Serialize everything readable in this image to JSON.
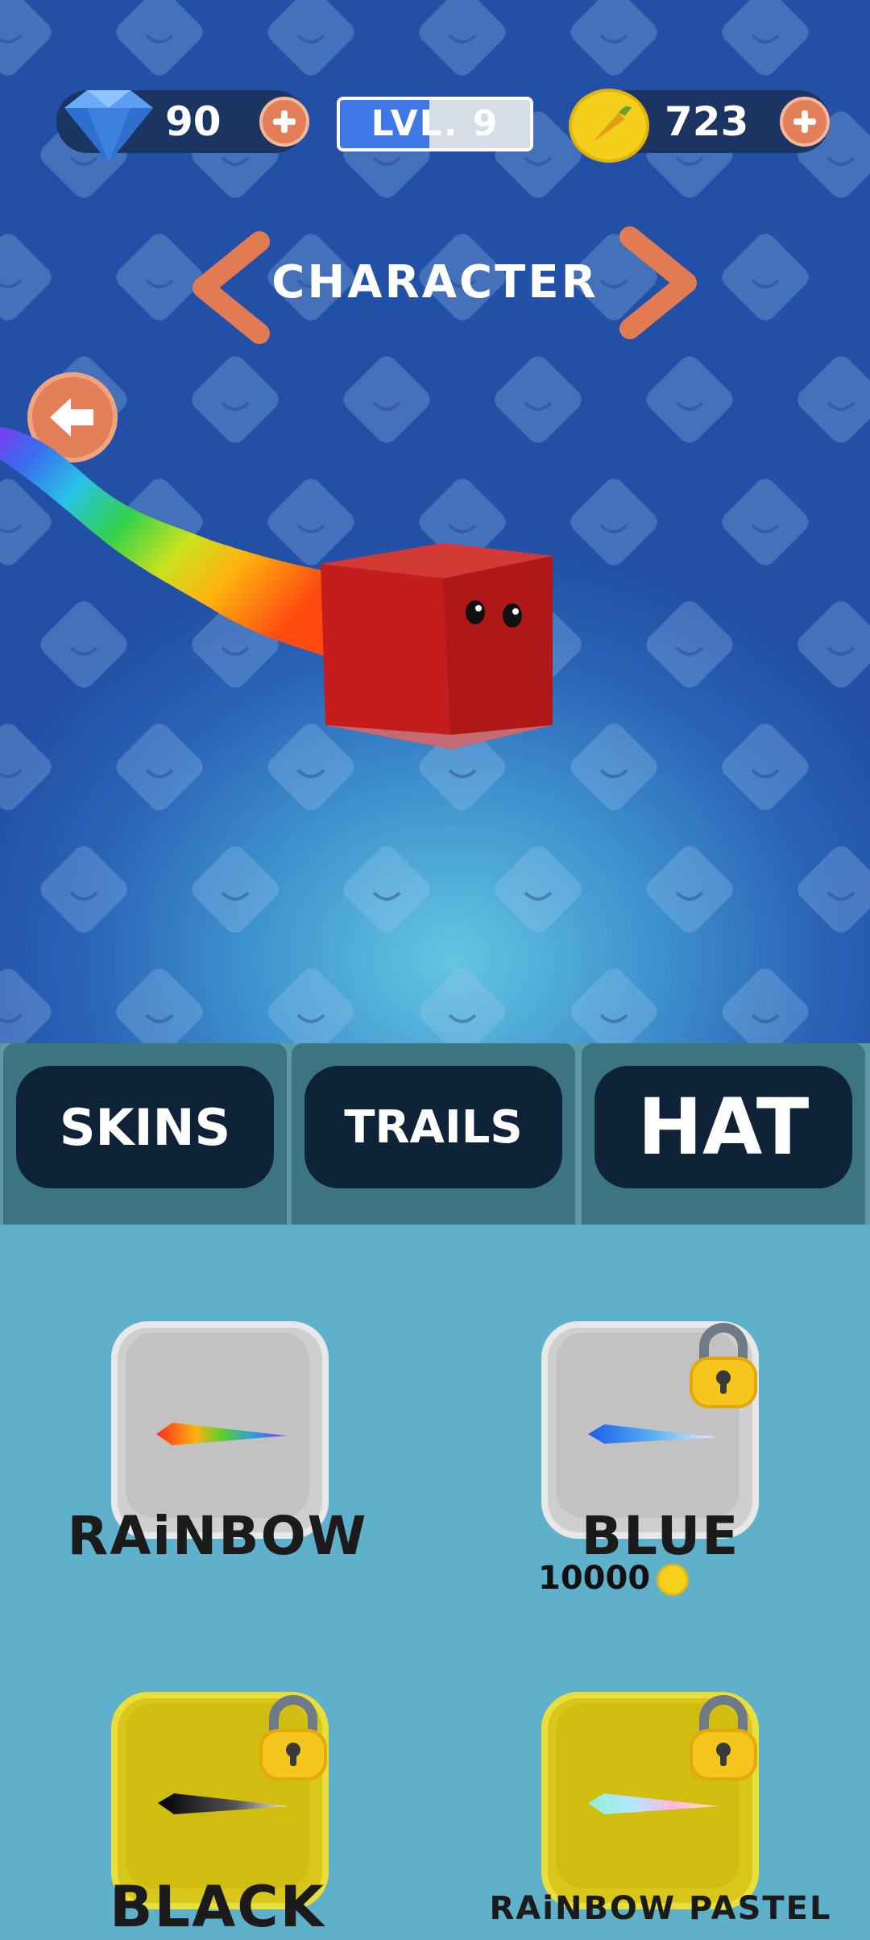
{
  "currency": {
    "gems": "90",
    "coins": "723",
    "level_text": "LVL. 9",
    "level_progress": 0.47
  },
  "title": "CHARACTER",
  "tabs": [
    {
      "label": "SKINS"
    },
    {
      "label": "TRAILS"
    },
    {
      "label": "HAT"
    }
  ],
  "items": [
    {
      "name": "RAiNBOW",
      "locked": false,
      "price": ""
    },
    {
      "name": "BLUE",
      "locked": true,
      "price": "10000"
    },
    {
      "name": "BLACK",
      "locked": true,
      "price": ""
    },
    {
      "name": "RAiNBOW PASTEL",
      "locked": true,
      "price": ""
    }
  ],
  "colors": {
    "accent_orange": "#e37f58",
    "pill_navy": "#1c3461",
    "level_fill": "#3f78e6",
    "tab_button": "#0f2338",
    "grid_bg": "#5fb0cb",
    "card_yellow": "#d8c71a",
    "card_grey": "#cfcfcf"
  },
  "icons": {
    "gem": "diamond-icon",
    "coin": "coin-icon",
    "plus": "plus-icon",
    "back": "back-arrow-icon",
    "lock": "padlock-icon",
    "prev": "chevron-left-icon",
    "next": "chevron-right-icon"
  }
}
